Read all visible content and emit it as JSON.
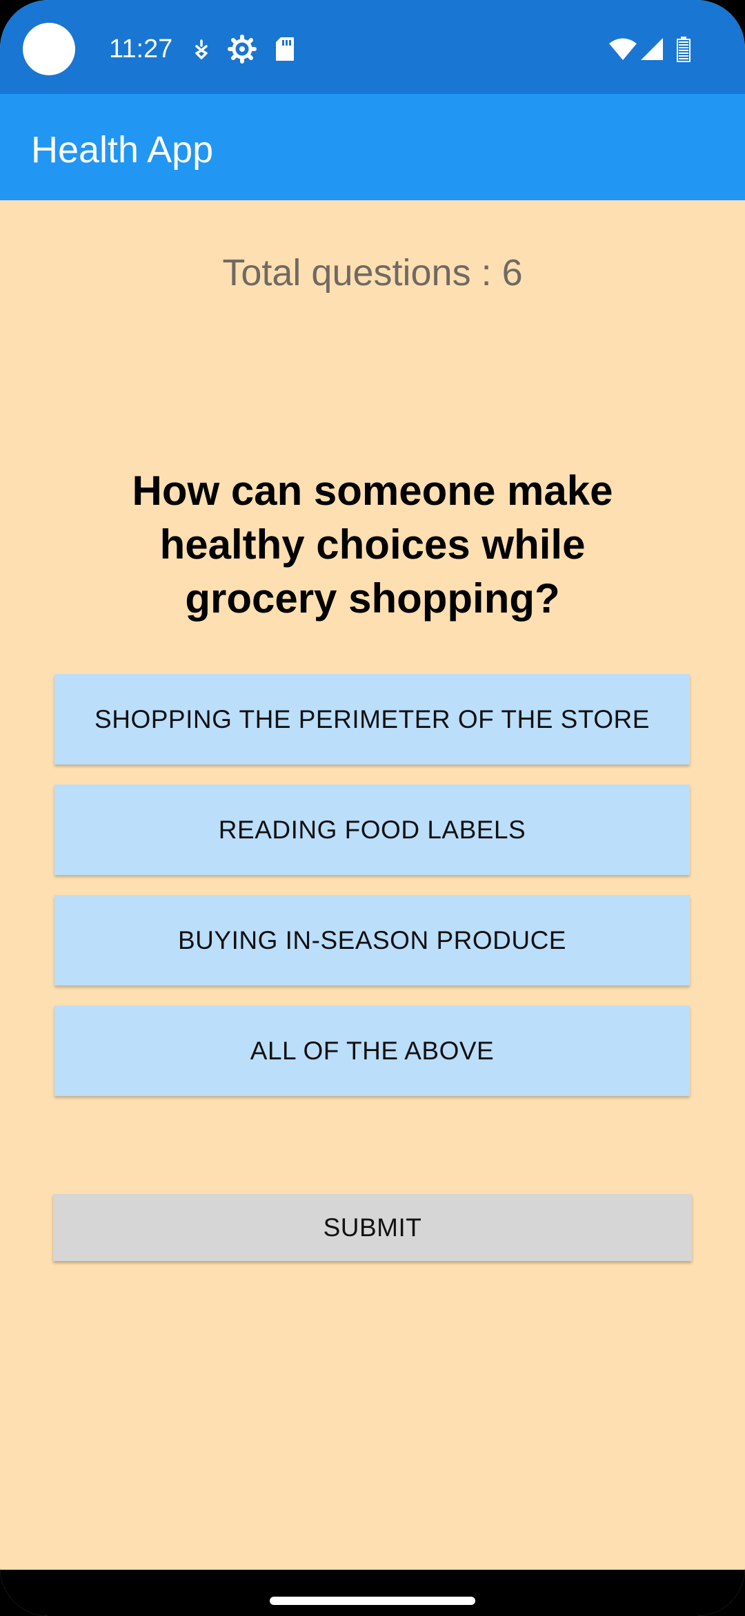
{
  "status_bar": {
    "time": "11:27",
    "icons": [
      "camera-cutout",
      "notification-icon",
      "settings-gear-icon",
      "sd-card-icon",
      "wifi-icon",
      "cell-signal-icon",
      "battery-icon"
    ]
  },
  "app_bar": {
    "title": "Health App"
  },
  "quiz": {
    "total_label": "Total questions : 6",
    "question": "How can someone make healthy choices while grocery shopping?",
    "options": [
      "SHOPPING THE PERIMETER OF THE STORE",
      "READING FOOD LABELS",
      "BUYING IN-SEASON PRODUCE",
      "ALL OF THE ABOVE"
    ],
    "submit_label": "SUBMIT"
  },
  "colors": {
    "status_bar": "#1976D2",
    "app_bar": "#2196F3",
    "background": "#FDDFB2",
    "option_button": "#BBDEFB",
    "submit_button": "#D6D6D6"
  }
}
